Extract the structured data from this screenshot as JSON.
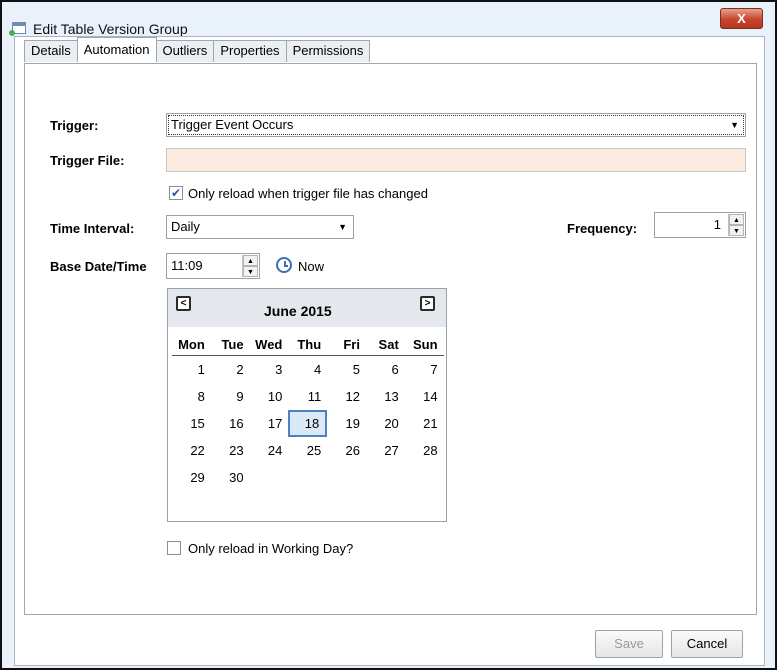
{
  "window": {
    "title": "Edit Table Version Group",
    "close_label": "X"
  },
  "tabs": [
    {
      "label": "Details"
    },
    {
      "label": "Automation"
    },
    {
      "label": "Outliers"
    },
    {
      "label": "Properties"
    },
    {
      "label": "Permissions"
    }
  ],
  "form": {
    "trigger_label": "Trigger:",
    "trigger_value": "Trigger Event Occurs",
    "trigger_file_label": "Trigger File:",
    "trigger_file_value": "",
    "only_reload_changed_label": "Only reload when trigger file has changed",
    "only_reload_changed_checked": true,
    "time_interval_label": "Time Interval:",
    "time_interval_value": "Daily",
    "frequency_label": "Frequency:",
    "frequency_value": "1",
    "base_datetime_label": "Base Date/Time",
    "base_time_value": "11:09",
    "now_label": "Now",
    "working_day_label": "Only reload in Working Day?",
    "working_day_checked": false
  },
  "calendar": {
    "month_title": "June 2015",
    "prev_label": "<",
    "next_label": ">",
    "weekdays": [
      "Mon",
      "Tue",
      "Wed",
      "Thu",
      "Fri",
      "Sat",
      "Sun"
    ],
    "weeks": [
      [
        "1",
        "2",
        "3",
        "4",
        "5",
        "6",
        "7"
      ],
      [
        "8",
        "9",
        "10",
        "11",
        "12",
        "13",
        "14"
      ],
      [
        "15",
        "16",
        "17",
        "18",
        "19",
        "20",
        "21"
      ],
      [
        "22",
        "23",
        "24",
        "25",
        "26",
        "27",
        "28"
      ],
      [
        "29",
        "30",
        "",
        "",
        "",
        "",
        ""
      ]
    ],
    "selected_day": "18"
  },
  "buttons": {
    "save_label": "Save",
    "cancel_label": "Cancel"
  }
}
